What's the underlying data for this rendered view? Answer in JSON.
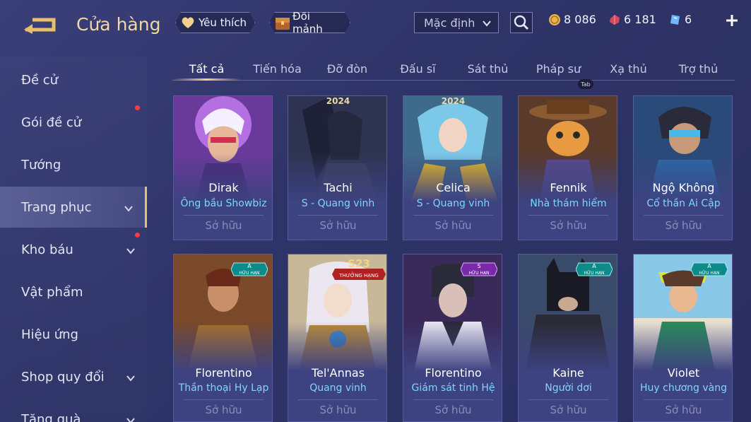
{
  "header": {
    "title": "Cửa hàng",
    "favorite_label": "Yêu thích",
    "exchange_label": "Đổi mảnh",
    "sort_value": "Mặc định",
    "gold": "8 086",
    "ruby": "6 181",
    "voucher": "6"
  },
  "sidebar": {
    "items": [
      {
        "label": "Đề cử"
      },
      {
        "label": "Gói đề cử"
      },
      {
        "label": "Tướng"
      },
      {
        "label": "Trang phục"
      },
      {
        "label": "Kho báu"
      },
      {
        "label": "Vật phẩm"
      },
      {
        "label": "Hiệu ứng"
      },
      {
        "label": "Shop quy đổi"
      },
      {
        "label": "Tặng quà"
      }
    ]
  },
  "tabs": {
    "items": [
      {
        "label": "Tất cả"
      },
      {
        "label": "Tiến hóa"
      },
      {
        "label": "Đỡ đòn"
      },
      {
        "label": "Đấu sĩ"
      },
      {
        "label": "Sát thủ"
      },
      {
        "label": "Pháp sư"
      },
      {
        "label": "Xạ thủ"
      },
      {
        "label": "Trợ thủ"
      }
    ],
    "hint": "Tab"
  },
  "cards": [
    {
      "hero": "Dirak",
      "skin": "Ông bầu Showbiz",
      "status": "Sở hữu"
    },
    {
      "hero": "Tachi",
      "skin": "S - Quang vinh",
      "status": "Sở hữu",
      "tag": "2024"
    },
    {
      "hero": "Celica",
      "skin": "S - Quang vinh",
      "status": "Sở hữu",
      "tag": "2024"
    },
    {
      "hero": "Fennik",
      "skin": "Nhà thám hiểm",
      "status": "Sở hữu"
    },
    {
      "hero": "Ngộ Không",
      "skin": "Cổ thần Ai Cập",
      "status": "Sở hữu"
    },
    {
      "hero": "Florentino",
      "skin": "Thần thoại Hy Lạp",
      "status": "Sở hữu",
      "grade": "A",
      "limited": "HỮU HẠN"
    },
    {
      "hero": "Tel'Annas",
      "skin": "Quang vinh",
      "status": "Sở hữu",
      "season": "S23",
      "season_sub": "THƯỞNG HẠNG"
    },
    {
      "hero": "Florentino",
      "skin": "Giám sát tinh Hệ",
      "status": "Sở hữu",
      "grade": "S",
      "limited": "HỮU HẠN"
    },
    {
      "hero": "Kaine",
      "skin": "Người dơi",
      "status": "Sở hữu",
      "grade": "A",
      "limited": "HỮU HẠN"
    },
    {
      "hero": "Violet",
      "skin": "Huy chương vàng",
      "status": "Sở hữu",
      "grade": "A",
      "limited": "HỮU HẠN"
    }
  ],
  "colors": {
    "accent_gold": "#f0d9a0",
    "skin_name": "#7fd5ff",
    "notification": "#ff3b3b"
  },
  "icons": [
    "back-arrow-icon",
    "heart-icon",
    "chest-icon",
    "chevron-down-icon",
    "search-icon",
    "gold-coin-icon",
    "ruby-icon",
    "voucher-icon",
    "plus-icon"
  ]
}
